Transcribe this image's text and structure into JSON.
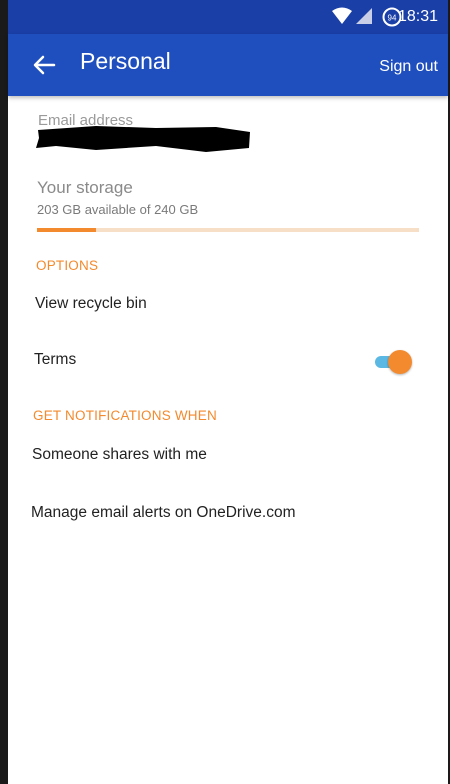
{
  "status_bar": {
    "time": "18:31",
    "battery_level": "94"
  },
  "app_bar": {
    "title": "Personal",
    "sign_out_label": "Sign out"
  },
  "account": {
    "email_label": "Email address"
  },
  "storage": {
    "title": "Your storage",
    "summary": "203 GB available of 240 GB",
    "used_fraction": 0.154
  },
  "options": {
    "header": "OPTIONS",
    "items": [
      {
        "label": "View recycle bin"
      },
      {
        "label": "Terms"
      }
    ]
  },
  "notifications": {
    "header": "GET NOTIFICATIONS WHEN",
    "shares_label": "Someone shares with me",
    "shares_enabled": true,
    "manage_label": "Manage email alerts on OneDrive.com"
  },
  "colors": {
    "accent": "#f38a2d",
    "app_bar": "#1f4fbf",
    "status_bar": "#1a3fa7",
    "toggle_track": "#5bb8e3"
  }
}
